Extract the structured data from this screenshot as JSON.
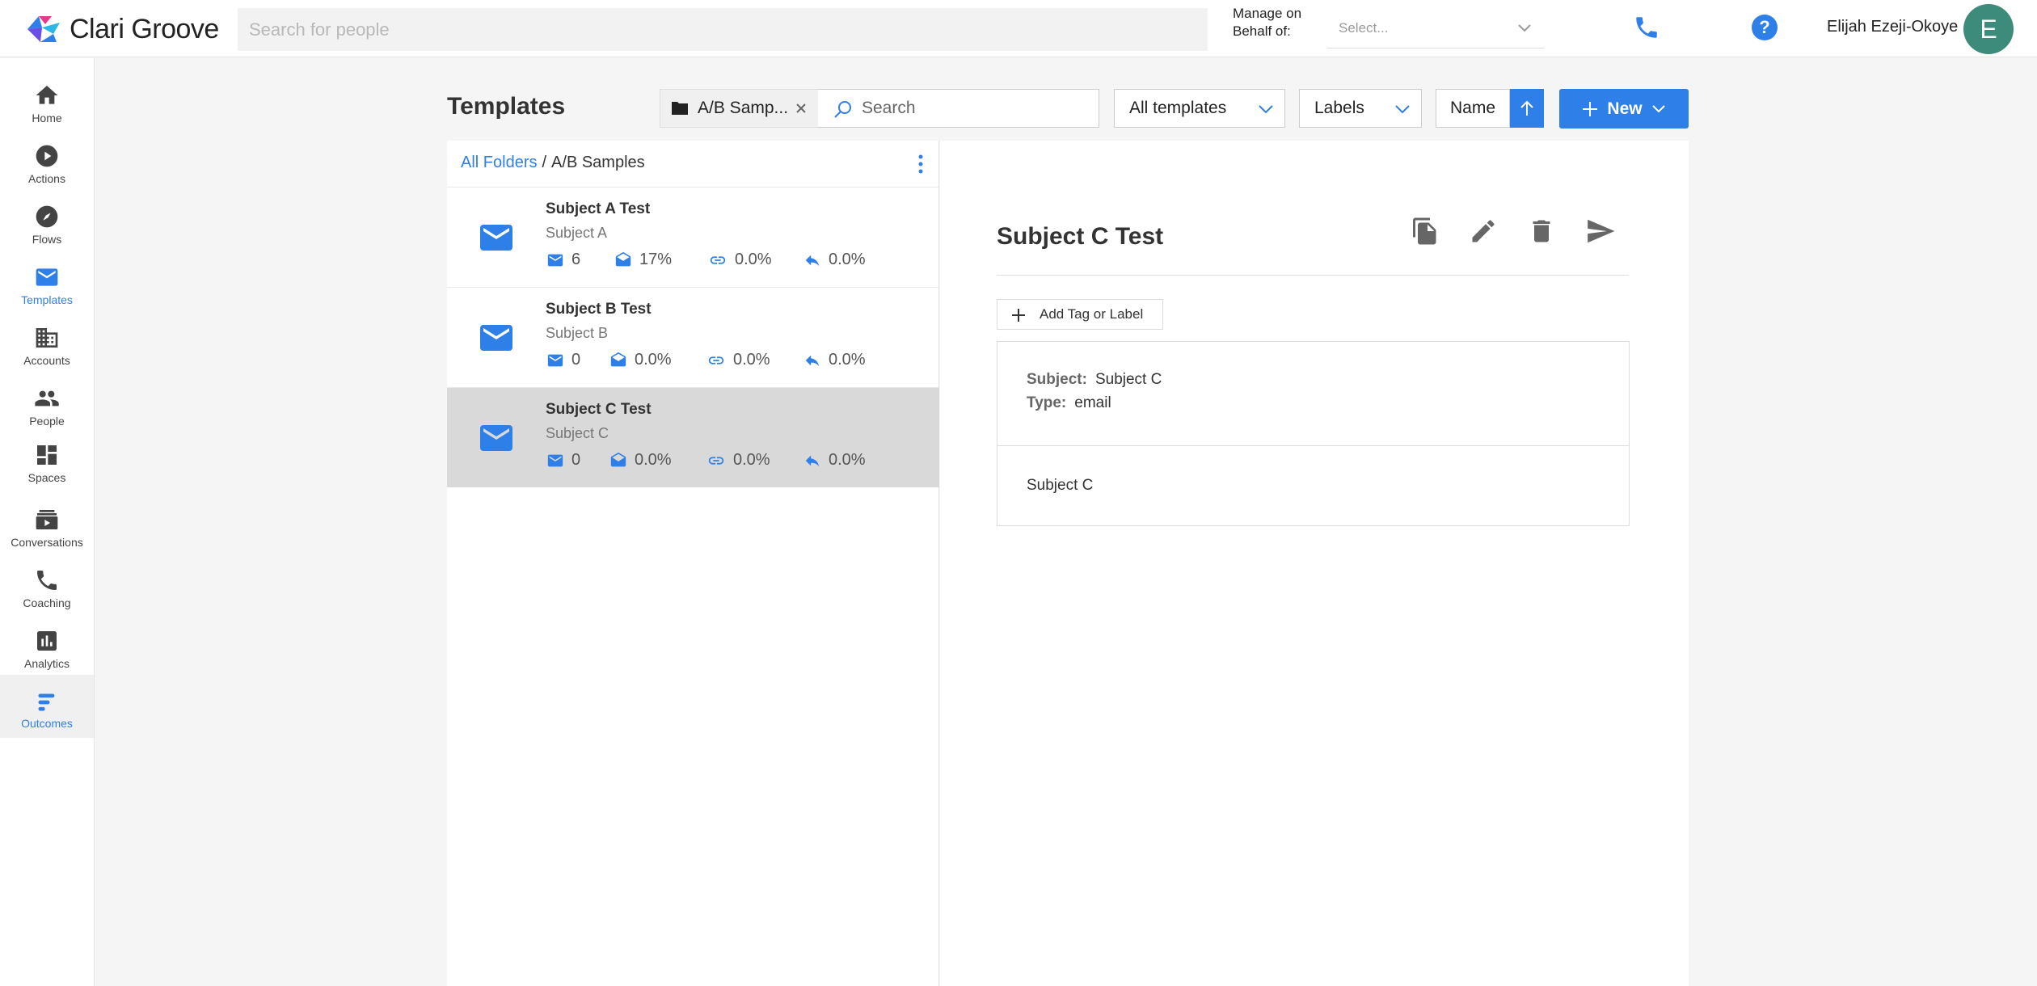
{
  "app": {
    "brand": "Clari Groove",
    "people_search_placeholder": "Search for people",
    "manage_on_behalf_label": "Manage on Behalf of:",
    "behalf_select_placeholder": "Select...",
    "user_name": "Elijah Ezeji-Okoye",
    "avatar_initial": "E"
  },
  "colors": {
    "accent": "#2f7fe8",
    "selected_row": "#d9d9d9",
    "avatar": "#3d8b7a"
  },
  "sidebar": {
    "items": [
      {
        "label": "Home",
        "icon": "home-icon"
      },
      {
        "label": "Actions",
        "icon": "play-circle-icon"
      },
      {
        "label": "Flows",
        "icon": "compass-icon"
      },
      {
        "label": "Templates",
        "icon": "mail-icon",
        "active": true
      },
      {
        "label": "Accounts",
        "icon": "building-icon"
      },
      {
        "label": "People",
        "icon": "people-icon"
      },
      {
        "label": "Spaces",
        "icon": "dashboard-icon"
      },
      {
        "label": "Conversations",
        "icon": "video-stack-icon"
      },
      {
        "label": "Coaching",
        "icon": "phone-icon"
      },
      {
        "label": "Analytics",
        "icon": "bar-chart-icon"
      },
      {
        "label": "Outcomes",
        "icon": "outcomes-icon",
        "active": true,
        "selected": true
      }
    ]
  },
  "toolbar": {
    "page_title": "Templates",
    "folder_chip": "A/B Samp...",
    "search_placeholder": "Search",
    "filter_templates": "All templates",
    "filter_labels": "Labels",
    "sort_field": "Name",
    "new_button": "New"
  },
  "list": {
    "breadcrumb_root": "All Folders",
    "breadcrumb_sep": "/",
    "breadcrumb_current": "A/B Samples",
    "rows": [
      {
        "title": "Subject A Test",
        "subject": "Subject A",
        "sent": "6",
        "opened": "17%",
        "clicked": "0.0%",
        "replied": "0.0%",
        "selected": false
      },
      {
        "title": "Subject B Test",
        "subject": "Subject B",
        "sent": "0",
        "opened": "0.0%",
        "clicked": "0.0%",
        "replied": "0.0%",
        "selected": false
      },
      {
        "title": "Subject C Test",
        "subject": "Subject C",
        "sent": "0",
        "opened": "0.0%",
        "clicked": "0.0%",
        "replied": "0.0%",
        "selected": true
      }
    ]
  },
  "detail": {
    "title": "Subject C Test",
    "add_tag_label": "Add Tag or Label",
    "subject_label": "Subject:",
    "subject_value": "Subject C",
    "type_label": "Type:",
    "type_value": "email",
    "body": "Subject C"
  }
}
